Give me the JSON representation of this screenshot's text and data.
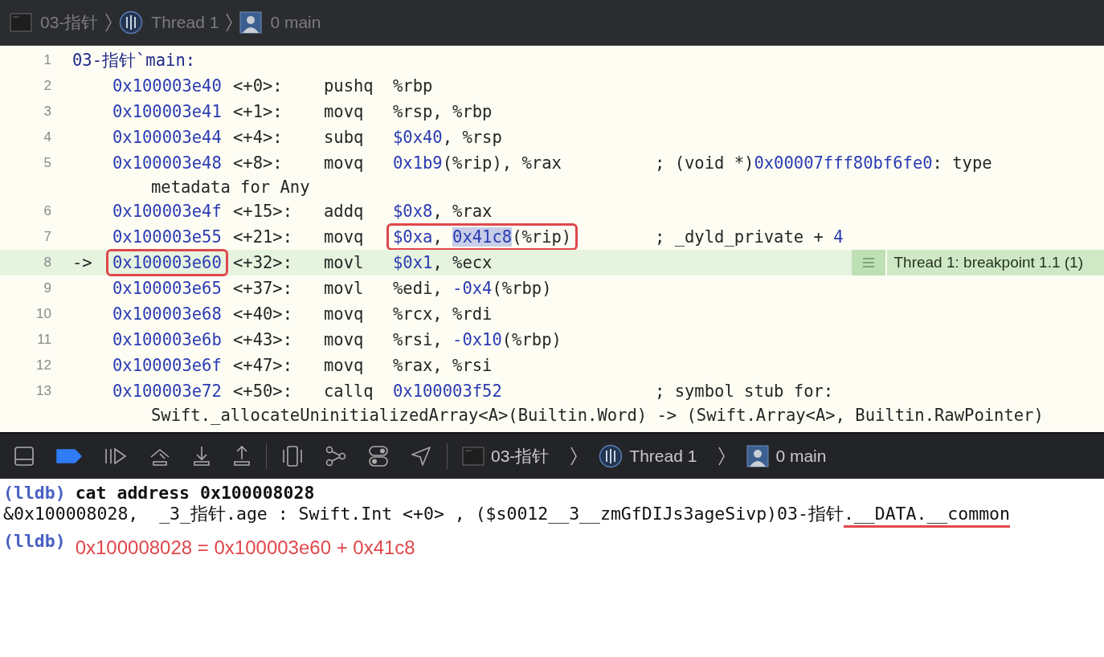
{
  "jump_bar": {
    "items": [
      {
        "kind": "file",
        "label": "03-指针"
      },
      {
        "kind": "thread",
        "label": "Thread 1"
      },
      {
        "kind": "frame",
        "label": "0 main"
      }
    ]
  },
  "disassembly": {
    "lines": [
      {
        "number": "1",
        "current": false,
        "label": "03-指针`main:"
      },
      {
        "number": "2",
        "current": false,
        "address": "0x100003e40",
        "offset": "<+0>:",
        "mnemonic": "pushq",
        "operands": [
          {
            "text": "%rbp",
            "kind": "text"
          }
        ]
      },
      {
        "number": "3",
        "current": false,
        "address": "0x100003e41",
        "offset": "<+1>:",
        "mnemonic": "movq",
        "operands": [
          {
            "text": "%rsp, %rbp",
            "kind": "text"
          }
        ]
      },
      {
        "number": "4",
        "current": false,
        "address": "0x100003e44",
        "offset": "<+4>:",
        "mnemonic": "subq",
        "operands": [
          {
            "text": "$0x40",
            "kind": "num"
          },
          {
            "text": ", %rsp",
            "kind": "text"
          }
        ]
      },
      {
        "number": "5",
        "current": false,
        "address": "0x100003e48",
        "offset": "<+8>:",
        "mnemonic": "movq",
        "operands": [
          {
            "text": "0x1b9",
            "kind": "num"
          },
          {
            "text": "(%rip), %rax",
            "kind": "text"
          }
        ],
        "comment": [
          {
            "text": "; (void *)",
            "kind": "text"
          },
          {
            "text": "0x00007fff80bf6fe0",
            "kind": "num"
          },
          {
            "text": ": type",
            "kind": "text"
          }
        ],
        "continuation": "metadata for Any"
      },
      {
        "number": "6",
        "current": false,
        "address": "0x100003e4f",
        "offset": "<+15>:",
        "mnemonic": "addq",
        "operands": [
          {
            "text": "$0x8",
            "kind": "num"
          },
          {
            "text": ", %rax",
            "kind": "text"
          }
        ]
      },
      {
        "number": "7",
        "current": false,
        "address": "0x100003e55",
        "offset": "<+21>:",
        "mnemonic": "movq",
        "operands_boxed": true,
        "operands": [
          {
            "text": "$0xa",
            "kind": "num",
            "highlighted": false
          },
          {
            "text": ", ",
            "kind": "text",
            "highlighted": false
          },
          {
            "text": "0x41c8",
            "kind": "num",
            "highlighted": true
          },
          {
            "text": "(%rip)",
            "kind": "text",
            "highlighted": false
          }
        ],
        "comment": [
          {
            "text": "; _dyld_private + ",
            "kind": "text"
          },
          {
            "text": "4",
            "kind": "num"
          }
        ]
      },
      {
        "number": "8",
        "current": true,
        "arrow": "->",
        "address": "0x100003e60",
        "offset": "<+32>:",
        "mnemonic": "movl",
        "address_boxed": true,
        "operands": [
          {
            "text": "$0x1",
            "kind": "num"
          },
          {
            "text": ", %ecx",
            "kind": "text"
          }
        ],
        "badge": "Thread 1: breakpoint 1.1 (1)"
      },
      {
        "number": "9",
        "current": false,
        "address": "0x100003e65",
        "offset": "<+37>:",
        "mnemonic": "movl",
        "operands": [
          {
            "text": "%edi, ",
            "kind": "text"
          },
          {
            "text": "-0x4",
            "kind": "num"
          },
          {
            "text": "(%rbp)",
            "kind": "text"
          }
        ]
      },
      {
        "number": "10",
        "current": false,
        "address": "0x100003e68",
        "offset": "<+40>:",
        "mnemonic": "movq",
        "operands": [
          {
            "text": "%rcx, %rdi",
            "kind": "text"
          }
        ]
      },
      {
        "number": "11",
        "current": false,
        "address": "0x100003e6b",
        "offset": "<+43>:",
        "mnemonic": "movq",
        "operands": [
          {
            "text": "%rsi, ",
            "kind": "text"
          },
          {
            "text": "-0x10",
            "kind": "num"
          },
          {
            "text": "(%rbp)",
            "kind": "text"
          }
        ]
      },
      {
        "number": "12",
        "current": false,
        "address": "0x100003e6f",
        "offset": "<+47>:",
        "mnemonic": "movq",
        "operands": [
          {
            "text": "%rax, %rsi",
            "kind": "text"
          }
        ]
      },
      {
        "number": "13",
        "current": false,
        "address": "0x100003e72",
        "offset": "<+50>:",
        "mnemonic": "callq",
        "operands": [
          {
            "text": "0x100003f52",
            "kind": "num"
          }
        ],
        "comment": [
          {
            "text": "; symbol stub for:",
            "kind": "text"
          }
        ],
        "continuation": "Swift._allocateUninitializedArray<A>(Builtin.Word) -> (Swift.Array<A>, Builtin.RawPointer)"
      }
    ]
  },
  "debug_bar": {
    "breakpoints_active": true,
    "jump_bar": {
      "items": [
        {
          "kind": "file",
          "label": "03-指针"
        },
        {
          "kind": "thread",
          "label": "Thread 1"
        },
        {
          "kind": "frame",
          "label": "0 main"
        }
      ]
    }
  },
  "console": {
    "lines": [
      {
        "kind": "command",
        "prompt": "(lldb)",
        "text": "cat address 0x100008028"
      },
      {
        "kind": "output",
        "segments": [
          {
            "text": "&0x100008028,  _3_指针.age : Swift.Int <+0> , ($s0012__3__zmGfDIJs3ageSivp)03-指针",
            "underlined": false
          },
          {
            "text": ".__DATA.__common",
            "underlined": true
          }
        ]
      },
      {
        "kind": "prompt",
        "prompt": "(lldb)",
        "note": "0x100008028 = 0x100003e60 + 0x41c8"
      }
    ]
  }
}
